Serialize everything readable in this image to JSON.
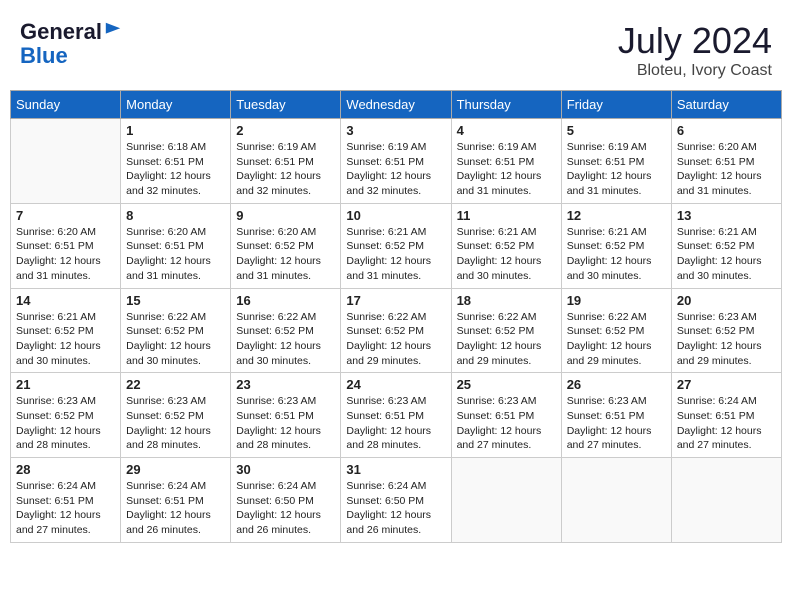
{
  "header": {
    "logo_general": "General",
    "logo_blue": "Blue",
    "month_year": "July 2024",
    "location": "Bloteu, Ivory Coast"
  },
  "days_of_week": [
    "Sunday",
    "Monday",
    "Tuesday",
    "Wednesday",
    "Thursday",
    "Friday",
    "Saturday"
  ],
  "weeks": [
    [
      {
        "day": "",
        "empty": true
      },
      {
        "day": "1",
        "sunrise": "Sunrise: 6:18 AM",
        "sunset": "Sunset: 6:51 PM",
        "daylight": "Daylight: 12 hours and 32 minutes."
      },
      {
        "day": "2",
        "sunrise": "Sunrise: 6:19 AM",
        "sunset": "Sunset: 6:51 PM",
        "daylight": "Daylight: 12 hours and 32 minutes."
      },
      {
        "day": "3",
        "sunrise": "Sunrise: 6:19 AM",
        "sunset": "Sunset: 6:51 PM",
        "daylight": "Daylight: 12 hours and 32 minutes."
      },
      {
        "day": "4",
        "sunrise": "Sunrise: 6:19 AM",
        "sunset": "Sunset: 6:51 PM",
        "daylight": "Daylight: 12 hours and 31 minutes."
      },
      {
        "day": "5",
        "sunrise": "Sunrise: 6:19 AM",
        "sunset": "Sunset: 6:51 PM",
        "daylight": "Daylight: 12 hours and 31 minutes."
      },
      {
        "day": "6",
        "sunrise": "Sunrise: 6:20 AM",
        "sunset": "Sunset: 6:51 PM",
        "daylight": "Daylight: 12 hours and 31 minutes."
      }
    ],
    [
      {
        "day": "7",
        "sunrise": "Sunrise: 6:20 AM",
        "sunset": "Sunset: 6:51 PM",
        "daylight": "Daylight: 12 hours and 31 minutes."
      },
      {
        "day": "8",
        "sunrise": "Sunrise: 6:20 AM",
        "sunset": "Sunset: 6:51 PM",
        "daylight": "Daylight: 12 hours and 31 minutes."
      },
      {
        "day": "9",
        "sunrise": "Sunrise: 6:20 AM",
        "sunset": "Sunset: 6:52 PM",
        "daylight": "Daylight: 12 hours and 31 minutes."
      },
      {
        "day": "10",
        "sunrise": "Sunrise: 6:21 AM",
        "sunset": "Sunset: 6:52 PM",
        "daylight": "Daylight: 12 hours and 31 minutes."
      },
      {
        "day": "11",
        "sunrise": "Sunrise: 6:21 AM",
        "sunset": "Sunset: 6:52 PM",
        "daylight": "Daylight: 12 hours and 30 minutes."
      },
      {
        "day": "12",
        "sunrise": "Sunrise: 6:21 AM",
        "sunset": "Sunset: 6:52 PM",
        "daylight": "Daylight: 12 hours and 30 minutes."
      },
      {
        "day": "13",
        "sunrise": "Sunrise: 6:21 AM",
        "sunset": "Sunset: 6:52 PM",
        "daylight": "Daylight: 12 hours and 30 minutes."
      }
    ],
    [
      {
        "day": "14",
        "sunrise": "Sunrise: 6:21 AM",
        "sunset": "Sunset: 6:52 PM",
        "daylight": "Daylight: 12 hours and 30 minutes."
      },
      {
        "day": "15",
        "sunrise": "Sunrise: 6:22 AM",
        "sunset": "Sunset: 6:52 PM",
        "daylight": "Daylight: 12 hours and 30 minutes."
      },
      {
        "day": "16",
        "sunrise": "Sunrise: 6:22 AM",
        "sunset": "Sunset: 6:52 PM",
        "daylight": "Daylight: 12 hours and 30 minutes."
      },
      {
        "day": "17",
        "sunrise": "Sunrise: 6:22 AM",
        "sunset": "Sunset: 6:52 PM",
        "daylight": "Daylight: 12 hours and 29 minutes."
      },
      {
        "day": "18",
        "sunrise": "Sunrise: 6:22 AM",
        "sunset": "Sunset: 6:52 PM",
        "daylight": "Daylight: 12 hours and 29 minutes."
      },
      {
        "day": "19",
        "sunrise": "Sunrise: 6:22 AM",
        "sunset": "Sunset: 6:52 PM",
        "daylight": "Daylight: 12 hours and 29 minutes."
      },
      {
        "day": "20",
        "sunrise": "Sunrise: 6:23 AM",
        "sunset": "Sunset: 6:52 PM",
        "daylight": "Daylight: 12 hours and 29 minutes."
      }
    ],
    [
      {
        "day": "21",
        "sunrise": "Sunrise: 6:23 AM",
        "sunset": "Sunset: 6:52 PM",
        "daylight": "Daylight: 12 hours and 28 minutes."
      },
      {
        "day": "22",
        "sunrise": "Sunrise: 6:23 AM",
        "sunset": "Sunset: 6:52 PM",
        "daylight": "Daylight: 12 hours and 28 minutes."
      },
      {
        "day": "23",
        "sunrise": "Sunrise: 6:23 AM",
        "sunset": "Sunset: 6:51 PM",
        "daylight": "Daylight: 12 hours and 28 minutes."
      },
      {
        "day": "24",
        "sunrise": "Sunrise: 6:23 AM",
        "sunset": "Sunset: 6:51 PM",
        "daylight": "Daylight: 12 hours and 28 minutes."
      },
      {
        "day": "25",
        "sunrise": "Sunrise: 6:23 AM",
        "sunset": "Sunset: 6:51 PM",
        "daylight": "Daylight: 12 hours and 27 minutes."
      },
      {
        "day": "26",
        "sunrise": "Sunrise: 6:23 AM",
        "sunset": "Sunset: 6:51 PM",
        "daylight": "Daylight: 12 hours and 27 minutes."
      },
      {
        "day": "27",
        "sunrise": "Sunrise: 6:24 AM",
        "sunset": "Sunset: 6:51 PM",
        "daylight": "Daylight: 12 hours and 27 minutes."
      }
    ],
    [
      {
        "day": "28",
        "sunrise": "Sunrise: 6:24 AM",
        "sunset": "Sunset: 6:51 PM",
        "daylight": "Daylight: 12 hours and 27 minutes."
      },
      {
        "day": "29",
        "sunrise": "Sunrise: 6:24 AM",
        "sunset": "Sunset: 6:51 PM",
        "daylight": "Daylight: 12 hours and 26 minutes."
      },
      {
        "day": "30",
        "sunrise": "Sunrise: 6:24 AM",
        "sunset": "Sunset: 6:50 PM",
        "daylight": "Daylight: 12 hours and 26 minutes."
      },
      {
        "day": "31",
        "sunrise": "Sunrise: 6:24 AM",
        "sunset": "Sunset: 6:50 PM",
        "daylight": "Daylight: 12 hours and 26 minutes."
      },
      {
        "day": "",
        "empty": true
      },
      {
        "day": "",
        "empty": true
      },
      {
        "day": "",
        "empty": true
      }
    ]
  ]
}
